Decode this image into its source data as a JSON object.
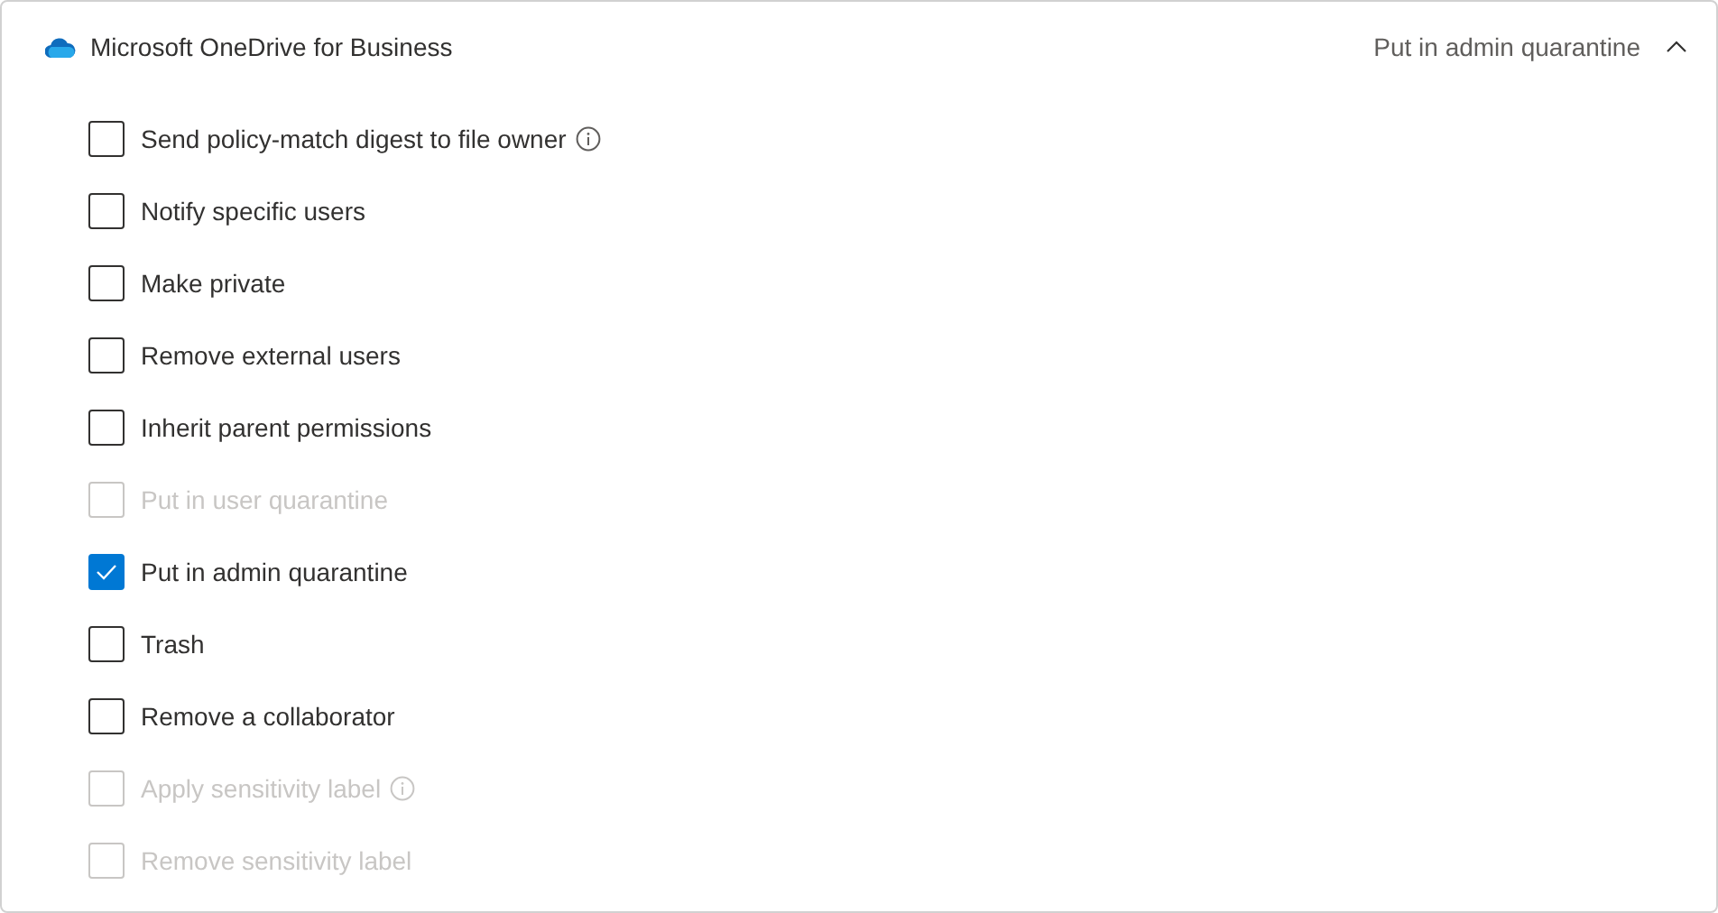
{
  "section": {
    "title": "Microsoft OneDrive for Business",
    "summary": "Put in admin quarantine",
    "expanded": true
  },
  "options": [
    {
      "label": "Send policy-match digest to file owner",
      "checked": false,
      "disabled": false,
      "info": true
    },
    {
      "label": "Notify specific users",
      "checked": false,
      "disabled": false,
      "info": false
    },
    {
      "label": "Make private",
      "checked": false,
      "disabled": false,
      "info": false
    },
    {
      "label": "Remove external users",
      "checked": false,
      "disabled": false,
      "info": false
    },
    {
      "label": "Inherit parent permissions",
      "checked": false,
      "disabled": false,
      "info": false
    },
    {
      "label": "Put in user quarantine",
      "checked": false,
      "disabled": true,
      "info": false
    },
    {
      "label": "Put in admin quarantine",
      "checked": true,
      "disabled": false,
      "info": false
    },
    {
      "label": "Trash",
      "checked": false,
      "disabled": false,
      "info": false
    },
    {
      "label": "Remove a collaborator",
      "checked": false,
      "disabled": false,
      "info": false
    },
    {
      "label": "Apply sensitivity label",
      "checked": false,
      "disabled": true,
      "info": true
    },
    {
      "label": "Remove sensitivity label",
      "checked": false,
      "disabled": true,
      "info": false
    }
  ]
}
